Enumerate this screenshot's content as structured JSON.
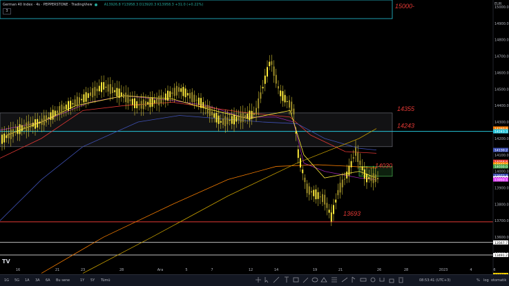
{
  "header": {
    "symbol": "German 40 Index · 4s · PEPPERSTONE · TradingView",
    "ohlc": "A13926.8 Y13958.3 D13920.3 K13958.3 +31.0 (+0.22%)",
    "collapse_label": "3"
  },
  "currency_label": "EUR",
  "price_scale": [
    "15000.0",
    "14900.0",
    "14800.0",
    "14700.0",
    "14600.0",
    "14500.0",
    "14400.0",
    "14300.0",
    "14200.0",
    "14100.0",
    "14000.0",
    "13900.0",
    "13800.0",
    "13700.0",
    "13600.0",
    "13500.0"
  ],
  "price_tags": [
    {
      "label": "14260.6",
      "color": "#f57c00",
      "value": 14260.6
    },
    {
      "label": "14243.3",
      "color": "#26c6da",
      "value": 14243.3
    },
    {
      "label": "14130.2",
      "color": "#3f51b5",
      "value": 14130.2
    },
    {
      "label": "14058.6",
      "color": "#e53935",
      "value": 14058.6
    },
    {
      "label": "14042.0",
      "color": "#ff9800",
      "value": 14042.0
    },
    {
      "label": "14030.0",
      "color": "#43a047",
      "value": 14030.0
    },
    {
      "label": "13973.4",
      "color": "#3949ab",
      "value": 13973.4
    },
    {
      "label": "13958.3",
      "color": "#ffffff",
      "value": 13958.3
    },
    {
      "label": "13950.1",
      "color": "#e040fb",
      "value": 13950.1
    },
    {
      "label": "13567.7",
      "color": "#ffffff",
      "value": 13567.7
    },
    {
      "label": "13491.2",
      "color": "#ffffff",
      "value": 13491.2
    },
    {
      "label": "13370.0",
      "color": "#ffd600",
      "value": 13370.0
    }
  ],
  "time_axis": [
    "16",
    "21",
    "23",
    "28",
    "Ara",
    "5",
    "7",
    "12",
    "14",
    "19",
    "21",
    "26",
    "28",
    "2023",
    "4",
    "6"
  ],
  "annotations": [
    {
      "text": "15000-",
      "value": 15000
    },
    {
      "text": "14355",
      "value": 14355
    },
    {
      "text": "14243",
      "value": 14243
    },
    {
      "text": "14030",
      "value": 14030
    },
    {
      "text": "13693",
      "value": 13693
    }
  ],
  "timeframes": [
    "1G",
    "5G",
    "1A",
    "3A",
    "6A",
    "Bu sene",
    "1Y",
    "5Y",
    "Tümü"
  ],
  "status": {
    "clock": "08:53:41 (UTC+3)",
    "percent": "%",
    "log": "log",
    "auto": "otomatik"
  },
  "colors": {
    "candle": "#ffeb3b",
    "resistance_zone_border": "#26c6da",
    "support_line": "#e53935",
    "zone_green": "#43a047"
  },
  "chart_data": {
    "type": "line",
    "title": "",
    "ylim": [
      13300,
      15080
    ],
    "x": [
      "16",
      "21",
      "23",
      "28",
      "Ara",
      "5",
      "7",
      "12",
      "14",
      "19",
      "21",
      "26"
    ],
    "series": [
      {
        "name": "",
        "values": [
          14190,
          14380,
          14500,
          14560,
          14470,
          14500,
          14390,
          14400,
          14380,
          13900,
          13880,
          13958
        ]
      }
    ],
    "levels": [
      15000,
      14355,
      14243,
      14030,
      13693,
      13567.7,
      13491.2
    ]
  }
}
